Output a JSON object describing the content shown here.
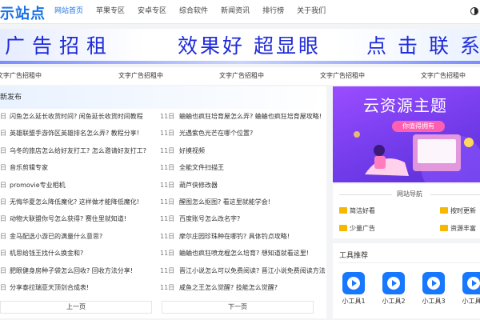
{
  "header": {
    "logo": "示站点",
    "nav": [
      "网站首页",
      "苹果专区",
      "安卓专区",
      "综合软件",
      "新闻资讯",
      "排行榜",
      "关于我们"
    ]
  },
  "banner": {
    "left": "广告招租",
    "middle": "效果好 超显眼",
    "right": "点击联系"
  },
  "text_ads": [
    "文字广告招租中",
    "文字广告招租中",
    "文字广告招租中",
    "文字广告招租中",
    "文字广告招租中"
  ],
  "latest": {
    "title": "新发布",
    "left": [
      {
        "date": "日",
        "title": "闪鱼怎么延长收货时间? 闲鱼延长收货时间教程"
      },
      {
        "date": "日",
        "title": "英雄联盟手游饰区英雄排名怎么弄? 教程分享!"
      },
      {
        "date": "日",
        "title": "乌冬的旅店怎么给好友打工? 怎么邀请好友打工?"
      },
      {
        "date": "日",
        "title": "音乐剪辑专家"
      },
      {
        "date": "日",
        "title": "promovie专业相机"
      },
      {
        "date": "日",
        "title": "无悔华夏怎么降低魔化? 这样做才能降低魔化!"
      },
      {
        "date": "日",
        "title": "动物大联盟你号怎么获得? 赛住里就知道!"
      },
      {
        "date": "日",
        "title": "金马配选小游已的满量什么意思?"
      },
      {
        "date": "日",
        "title": "机思给钱王找什么换金和?"
      },
      {
        "date": "日",
        "title": "肥眼健身房种子袋怎么回收? 回收方法分享!"
      },
      {
        "date": "日",
        "title": "分享泰拉瑞亚天顶剑合成表!"
      }
    ],
    "right": [
      {
        "date": "11日",
        "title": "蛐蛐也疯狂培育屋怎么弄? 蛐蛐也疯狂培育屋攻略!"
      },
      {
        "date": "11日",
        "title": "光遇紫色光芒在哪个位置?"
      },
      {
        "date": "11日",
        "title": "好摸视频"
      },
      {
        "date": "11日",
        "title": "全能文件扫描王"
      },
      {
        "date": "11日",
        "title": "葫芦侠修改器"
      },
      {
        "date": "11日",
        "title": "醒图怎么抠图? 看这里就能学会!"
      },
      {
        "date": "11日",
        "title": "百度账号怎么改名字?"
      },
      {
        "date": "11日",
        "title": "摩尔庄园珍珠种在哪钓? 具体钓点攻略!"
      },
      {
        "date": "11日",
        "title": "蛐蛐也疯狂喷龙棍怎么培育? 想知道就看这里!"
      },
      {
        "date": "11日",
        "title": "晋江小说怎么可以免费阅读? 晋江小说免费阅读方法"
      },
      {
        "date": "11日",
        "title": "咸鱼之王怎么觉醒? 技能怎么觉醒?"
      }
    ],
    "pager": {
      "prev": "上一页",
      "next": "下一页"
    }
  },
  "poster": {
    "title": "云资源主题",
    "tag": "你值得拥有"
  },
  "site_nav": {
    "title": "网站导航",
    "items": [
      {
        "label": "简洁好看",
        "icon": "envelope-icon"
      },
      {
        "label": "按时更新",
        "icon": "envelope-icon"
      },
      {
        "label": "少量广告",
        "icon": "envelope-icon"
      },
      {
        "label": "资源丰富",
        "icon": "envelope-icon"
      }
    ]
  },
  "tools": {
    "title": "工具推荐",
    "items": [
      "小工具1",
      "小工具2",
      "小工具3",
      "小工具4"
    ]
  },
  "colors": {
    "accent": "#1a73e8",
    "banner_text": "#1f2bd8",
    "tool_icon": "#1677ff",
    "poster": "#7a3ff0"
  }
}
